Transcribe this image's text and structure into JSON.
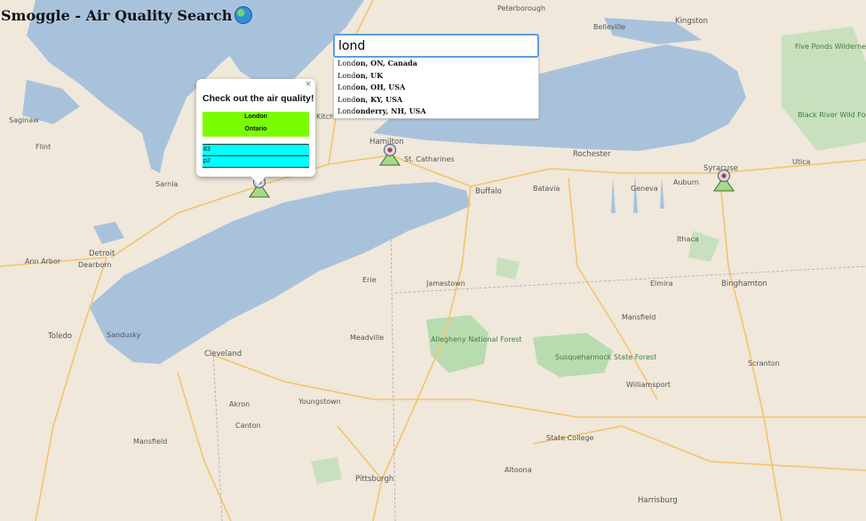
{
  "header": {
    "title": "Smoggle - Air Quality Search",
    "icon": "globe-icon"
  },
  "search": {
    "value": "lond",
    "suggestions": [
      {
        "match": "Lond",
        "rest": "on, ON, Canada"
      },
      {
        "match": "Lond",
        "rest": "on, UK"
      },
      {
        "match": "Lond",
        "rest": "on, OH, USA"
      },
      {
        "match": "Lond",
        "rest": "on, KY, USA"
      },
      {
        "match": "Lond",
        "rest": "onderry, NH, USA"
      }
    ]
  },
  "popup": {
    "title": "Check out the air quality!",
    "close": "×",
    "city": "London",
    "region": "Ontario",
    "readings": [
      "83",
      "p2"
    ],
    "colors": {
      "place": "#7cfc00",
      "aq": "#00ffff"
    }
  },
  "map": {
    "labels": {
      "hamilton": "Hamilton",
      "buffalo": "Buffalo",
      "rochester": "Rochester",
      "syracuse": "Syracuse",
      "detroit": "Detroit",
      "toledo": "Toledo",
      "cleveland": "Cleveland",
      "erie": "Erie",
      "pittsburgh": "Pittsburgh",
      "kingston": "Kingston",
      "allegheny": "Allegheny National Forest",
      "susquehannock": "Susquehannock State Forest",
      "fivePonds": "Five Ponds Wilderness",
      "blackRiver": "Black River Wild Forest",
      "belleville": "Belleville",
      "peterborough": "Peterborough",
      "ithaca": "Ithaca",
      "binghamton": "Binghamton",
      "scranton": "Scranton",
      "harrisburg": "Harrisburg",
      "altoona": "Altoona",
      "stateCollege": "State College",
      "youngstown": "Youngstown",
      "akron": "Akron",
      "canton": "Canton",
      "sarnia": "Sarnia",
      "annArbor": "Ann Arbor",
      "utica": "Utica",
      "elmira": "Elmira",
      "mansfield": "Mansfield",
      "stCatharines": "St. Catharines",
      "flint": "Flint",
      "saginaw": "Saginaw",
      "kitchener": "Kitchener",
      "dearborn": "Dearborn",
      "sandusky": "Sandusky",
      "meadville": "Meadville",
      "jamestown": "Jamestown",
      "williamsport": "Williamsport",
      "batavia": "Batavia",
      "auburn": "Auburn",
      "geneva": "Geneva"
    },
    "markers": [
      "pin-marker-london",
      "pin-marker-hamilton",
      "pin-marker-syracuse"
    ],
    "colors": {
      "land": "#efe8db",
      "water": "#a9c2dc",
      "park": "#b9dbb0",
      "road": "#f5c46a"
    }
  }
}
